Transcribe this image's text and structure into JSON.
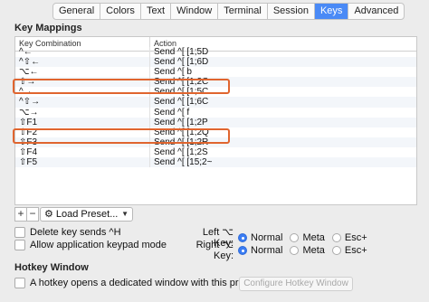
{
  "tabs": [
    {
      "label": "General",
      "active": false
    },
    {
      "label": "Colors",
      "active": false
    },
    {
      "label": "Text",
      "active": false
    },
    {
      "label": "Window",
      "active": false
    },
    {
      "label": "Terminal",
      "active": false
    },
    {
      "label": "Session",
      "active": false
    },
    {
      "label": "Keys",
      "active": true
    },
    {
      "label": "Advanced",
      "active": false
    }
  ],
  "key_mappings": {
    "title": "Key Mappings",
    "columns": {
      "key_combination": "Key Combination",
      "action": "Action"
    },
    "rows": [
      {
        "key": "^←",
        "action": "Send ^[ [1;5D"
      },
      {
        "key": "^⇧←",
        "action": "Send ^[ [1;6D"
      },
      {
        "key": "⌥←",
        "action": "Send ^[ b",
        "highlighted": true
      },
      {
        "key": "⇧→",
        "action": "Send ^[ [1;2C"
      },
      {
        "key": "^→",
        "action": "Send ^[ [1;5C"
      },
      {
        "key": "^⇧→",
        "action": "Send ^[ [1;6C"
      },
      {
        "key": "⌥→",
        "action": "Send ^[ f",
        "highlighted": true
      },
      {
        "key": "⇧F1",
        "action": "Send ^[ [1;2P"
      },
      {
        "key": "⇧F2",
        "action": "Send ^[ [1;2Q"
      },
      {
        "key": "⇧F3",
        "action": "Send ^[ [1;2R"
      },
      {
        "key": "⇧F4",
        "action": "Send ^[ [1;2S"
      },
      {
        "key": "⇧F5",
        "action": "Send ^[ [15;2~"
      }
    ]
  },
  "toolbar": {
    "add": "+",
    "remove": "−",
    "load_preset": "Load Preset..."
  },
  "checkboxes": {
    "delete_sends_h": "Delete key sends ^H",
    "app_keypad": "Allow application keypad mode"
  },
  "left_key": {
    "label": "Left ⌥ Key:",
    "options": [
      {
        "label": "Normal",
        "selected": true
      },
      {
        "label": "Meta",
        "selected": false
      },
      {
        "label": "Esc+",
        "selected": false
      }
    ]
  },
  "right_key": {
    "label": "Right ⌥ Key:",
    "options": [
      {
        "label": "Normal",
        "selected": true
      },
      {
        "label": "Meta",
        "selected": false
      },
      {
        "label": "Esc+",
        "selected": false
      }
    ]
  },
  "hotkey": {
    "title": "Hotkey Window",
    "checkbox_label": "A hotkey opens a dedicated window with this profile.",
    "configure_button": "Configure Hotkey Window"
  },
  "colors": {
    "accent": "#4a8af6",
    "highlight": "#e0652f"
  }
}
